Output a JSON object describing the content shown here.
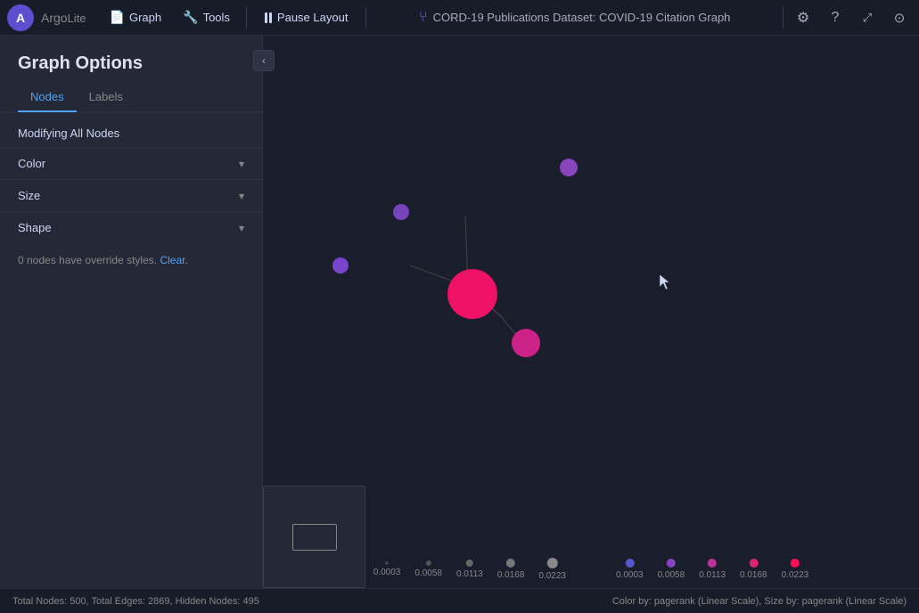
{
  "app": {
    "logo_label": "A",
    "brand": "Argo",
    "brand_suffix": "Lite"
  },
  "topnav": {
    "graph_label": "Graph",
    "tools_label": "Tools",
    "pause_layout_label": "Pause Layout",
    "dataset_icon": "⑂",
    "dataset_label": "CORD-19 Publications Dataset: COVID-19 Citation Graph",
    "settings_icon": "⚙",
    "help_icon": "?",
    "minimize_icon": "⤢",
    "github_icon": "🐙"
  },
  "sidebar": {
    "collapse_icon": "‹",
    "title": "Graph Options",
    "tabs": [
      {
        "label": "Nodes",
        "active": true
      },
      {
        "label": "Labels",
        "active": false
      }
    ],
    "modifying_label": "Modifying All Nodes",
    "options": [
      {
        "label": "Color"
      },
      {
        "label": "Size"
      },
      {
        "label": "Shape"
      }
    ],
    "override_text": "0 nodes have override styles.",
    "override_link": "Clear."
  },
  "legend": {
    "size_dots": [
      {
        "size": 4,
        "color": "#222533",
        "value": "0.0003"
      },
      {
        "size": 5,
        "color": "#333",
        "value": "0.0058"
      },
      {
        "size": 6,
        "color": "#444",
        "value": "0.0113"
      },
      {
        "size": 7,
        "color": "#555",
        "value": "0.0168"
      },
      {
        "size": 8,
        "color": "#666",
        "value": "0.0223"
      }
    ],
    "color_dots": [
      {
        "size": 7,
        "color": "#6060cc",
        "value": "0.0003"
      },
      {
        "size": 7,
        "color": "#8855bb",
        "value": "0.0058"
      },
      {
        "size": 7,
        "color": "#bb44aa",
        "value": "0.0113"
      },
      {
        "size": 7,
        "color": "#dd2288",
        "value": "0.0168"
      },
      {
        "size": 7,
        "color": "#ff1166",
        "value": "0.0223"
      }
    ]
  },
  "statusbar": {
    "nodes_info": "Total Nodes: 500, Total Edges: 2869, Hidden Nodes: 495",
    "color_info": "Color by: pagerank (Linear Scale), Size by: pagerank (Linear Scale)"
  }
}
